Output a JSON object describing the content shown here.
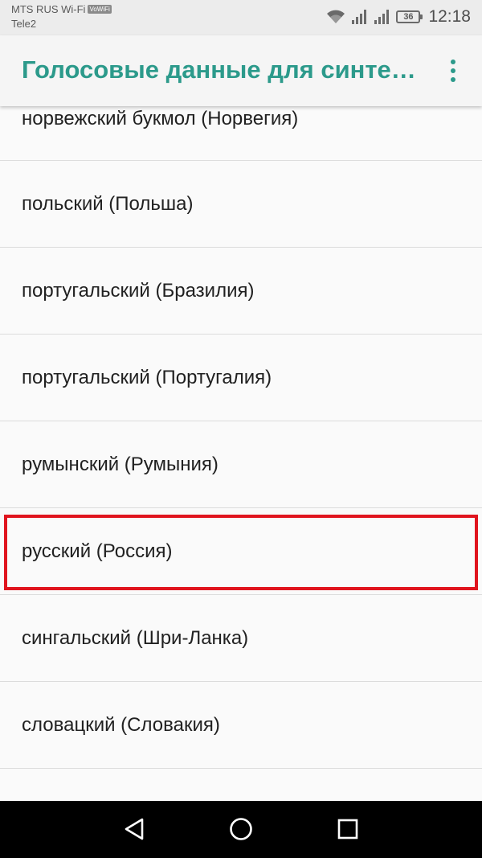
{
  "status_bar": {
    "carrier_1": "MTS RUS Wi-Fi",
    "volte_badge": "VoWiFi",
    "carrier_2": "Tele2",
    "battery_level": "36",
    "time": "12:18"
  },
  "app_bar": {
    "title": "Голосовые данные для синте…",
    "title_color": "#2c9a8b"
  },
  "languages": [
    "норвежский букмол (Норвегия)",
    "польский (Польша)",
    "португальский (Бразилия)",
    "португальский (Португалия)",
    "румынский (Румыния)",
    "русский (Россия)",
    "сингальский (Шри-Ланка)",
    "словацкий (Словакия)",
    ""
  ],
  "highlighted_index": 5,
  "highlight_color": "#e0141e",
  "nav_bar": {
    "back_icon": "back-triangle-icon",
    "home_icon": "home-circle-icon",
    "recents_icon": "recents-square-icon"
  }
}
